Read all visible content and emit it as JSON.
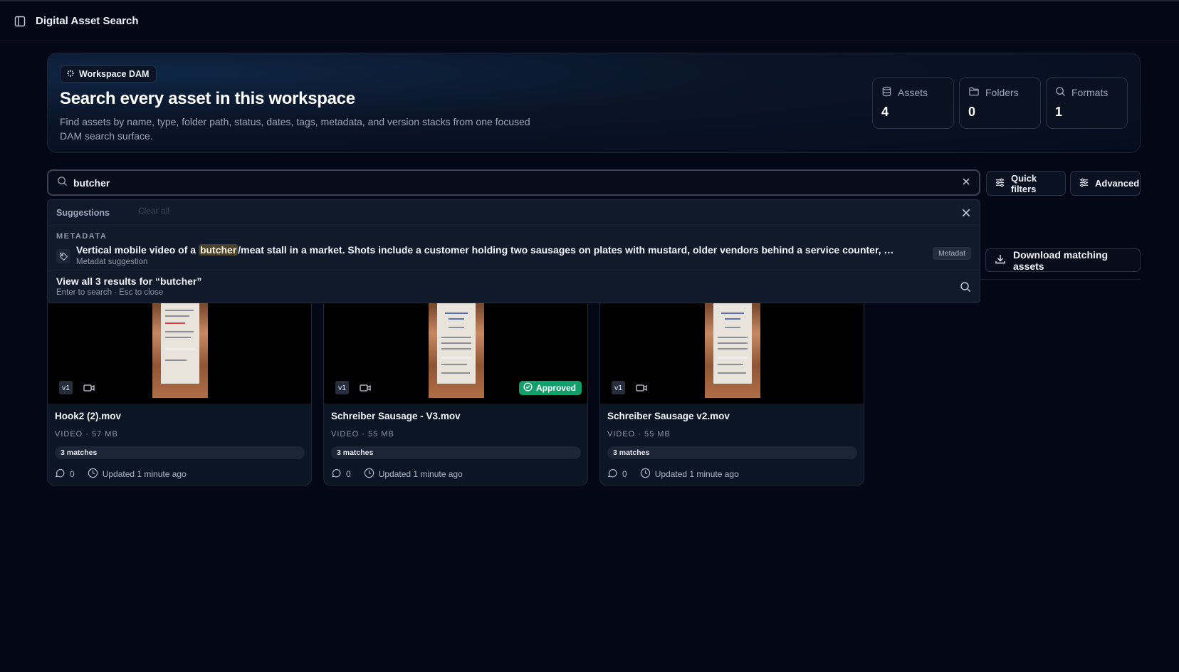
{
  "app": {
    "title": "Digital Asset Search"
  },
  "hero": {
    "badge": "Workspace DAM",
    "heading": "Search every asset in this workspace",
    "description": "Find assets by name, type, folder path, status, dates, tags, metadata, and version stacks from one focused DAM search surface.",
    "stats": [
      {
        "label": "Assets",
        "value": "4",
        "icon": "database-icon"
      },
      {
        "label": "Folders",
        "value": "0",
        "icon": "folder-icon"
      },
      {
        "label": "Formats",
        "value": "1",
        "icon": "search-icon"
      }
    ]
  },
  "search": {
    "value": "butcher",
    "placeholder": ""
  },
  "toolbar": {
    "quick_filters": "Quick filters",
    "advanced": "Advanced",
    "download": "Download matching assets"
  },
  "suggestions": {
    "title": "Suggestions",
    "clear": "Clear all",
    "section": "METADATA",
    "item": {
      "prefix": "Vertical mobile video of a ",
      "highlight": "butcher",
      "suffix": "/meat stall in a market. Shots include a customer holding two sausages on plates with mustard, older vendors behind a service counter, hanging cured meats, ...",
      "sub": "Metadat suggestion",
      "badge": "Metadat"
    },
    "view_all": "View all 3 results for “butcher”",
    "hint": "Enter to search · Esc to close"
  },
  "cards": [
    {
      "name": "Hook2 (2).mov",
      "meta": "VIDEO · 57 MB",
      "version": "v1",
      "matches": "3 matches",
      "comments": "0",
      "updated": "Updated 1 minute ago",
      "status": ""
    },
    {
      "name": "Schreiber Sausage - V3.mov",
      "meta": "VIDEO · 55 MB",
      "version": "v1",
      "matches": "3 matches",
      "comments": "0",
      "updated": "Updated 1 minute ago",
      "status": "Approved"
    },
    {
      "name": "Schreiber Sausage v2.mov",
      "meta": "VIDEO · 55 MB",
      "version": "v1",
      "matches": "3 matches",
      "comments": "0",
      "updated": "Updated 1 minute ago",
      "status": ""
    }
  ],
  "colors": {
    "background": "#040816",
    "approved": "#11a06b",
    "highlight": "#4a432c"
  }
}
